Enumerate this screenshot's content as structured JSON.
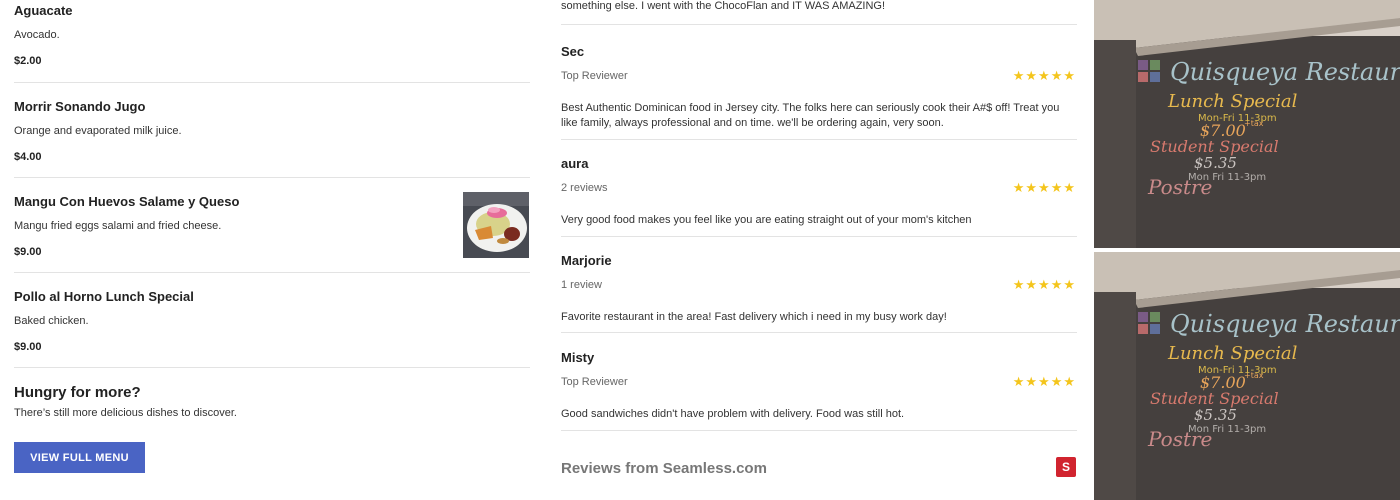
{
  "menu": {
    "items": [
      {
        "name": "Aguacate",
        "desc": "Avocado.",
        "price": "$2.00"
      },
      {
        "name": "Morrir Sonando Jugo",
        "desc": "Orange and evaporated milk juice.",
        "price": "$4.00"
      },
      {
        "name": "Mangu Con Huevos Salame y Queso",
        "desc": "Mangu fried eggs salami and fried cheese.",
        "price": "$9.00"
      },
      {
        "name": "Pollo al Horno Lunch Special",
        "desc": "Baked chicken.",
        "price": "$9.00"
      }
    ],
    "hungry_title": "Hungry for more?",
    "hungry_sub": "There’s still more delicious dishes to discover.",
    "full_menu_label": "VIEW FULL MENU"
  },
  "reviews": {
    "first_line": "something else. I went with the ChocoFlan and IT WAS AMAZING!",
    "items": [
      {
        "reviewer": "Sec",
        "meta": "Top Reviewer",
        "rating": 5,
        "text": "Best Authentic Dominican food in Jersey city. The folks here can seriously cook their A#$ off! Treat you like family, always professional and on time. we'll be ordering again, very soon."
      },
      {
        "reviewer": "aura",
        "meta": "2 reviews",
        "rating": 5,
        "text": "Very good food makes you feel like you are eating straight out of your mom's kitchen"
      },
      {
        "reviewer": "Marjorie",
        "meta": "1 review",
        "rating": 5,
        "text": "Favorite restaurant in the area! Fast delivery which i need in my busy work day!"
      },
      {
        "reviewer": "Misty",
        "meta": "Top Reviewer",
        "rating": 5,
        "text": "Good sandwiches didn't have problem with delivery. Food was still hot."
      }
    ],
    "source_title": "Reviews from Seamless.com",
    "source_logo_letter": "S"
  },
  "chalkboard": {
    "brand": "Quisqueya Restaurant",
    "lunch_special": "Lunch Special",
    "hours": "Mon-Fri 11-3pm",
    "lunch_price": "$7.00",
    "tax": "+tax",
    "student_special": "Student Special",
    "student_price": "$5.35",
    "student_hours": "Mon Fri 11-3pm",
    "postre": "Postre"
  },
  "colors": {
    "button": "#4a64c4",
    "star": "#f4c51c",
    "seamless": "#d1242f"
  }
}
